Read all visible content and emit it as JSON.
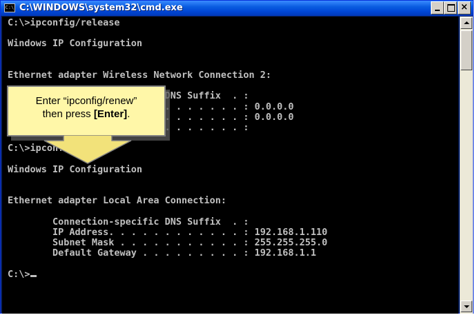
{
  "window": {
    "title": "C:\\WINDOWS\\system32\\cmd.exe",
    "icon": "cmd-icon",
    "icon_glyph": "C:\\",
    "close_glyph": "×"
  },
  "console": {
    "lines": [
      "C:\\>ipconfig/release",
      "",
      "Windows IP Configuration",
      "",
      "",
      "Ethernet adapter Wireless Network Connection 2:",
      "",
      "        Connection-specific DNS Suffix  . :",
      "        IP Address. . . . . . . . . . . . : 0.0.0.0",
      "        Subnet Mask . . . . . . . . . . . : 0.0.0.0",
      "        Default Gateway . . . . . . . . . :",
      "",
      "C:\\>ipconfig/renew",
      "",
      "Windows IP Configuration",
      "",
      "",
      "Ethernet adapter Local Area Connection:",
      "",
      "        Connection-specific DNS Suffix  . :",
      "        IP Address. . . . . . . . . . . . : 192.168.1.110",
      "        Subnet Mask . . . . . . . . . . . : 255.255.255.0",
      "        Default Gateway . . . . . . . . . : 192.168.1.1",
      "",
      "C:\\>"
    ],
    "text_color": "#c0c0c0",
    "background": "#000000"
  },
  "callout": {
    "line1": "Enter “ipconfig/renew”",
    "line2_prefix": "then press ",
    "line2_key": "[Enter]",
    "line2_suffix": ".",
    "background": "#fff7a8",
    "arrow_color": "#f2e27a"
  },
  "colors": {
    "titlebar": "#0a5ce0",
    "chrome": "#d4d0c8"
  }
}
